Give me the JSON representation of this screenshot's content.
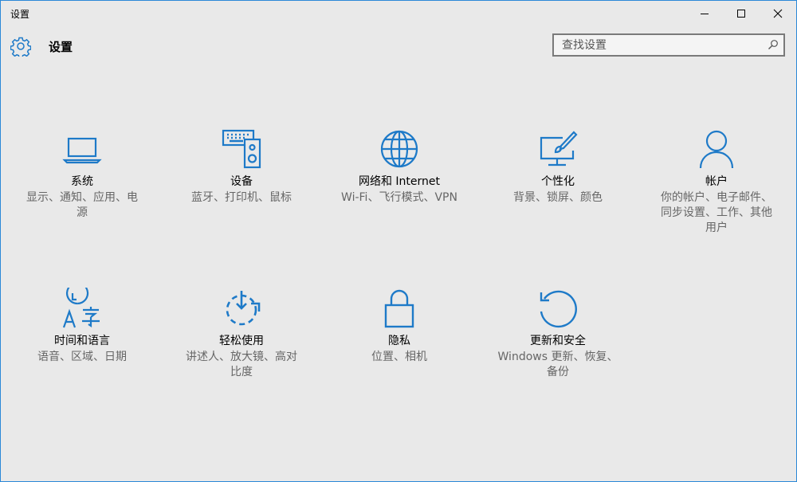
{
  "window": {
    "title": "设置",
    "controls": {
      "minimize": "minimize-icon",
      "maximize": "maximize-icon",
      "close": "close-icon"
    }
  },
  "header": {
    "title": "设置",
    "search_placeholder": "查找设置"
  },
  "accent_color": "#1e7ac8",
  "categories": [
    {
      "icon": "laptop-icon",
      "name": "系统",
      "desc": "显示、通知、应用、电源"
    },
    {
      "icon": "devices-icon",
      "name": "设备",
      "desc": "蓝牙、打印机、鼠标"
    },
    {
      "icon": "globe-icon",
      "name": "网络和 Internet",
      "desc": "Wi-Fi、飞行模式、VPN"
    },
    {
      "icon": "personalization-icon",
      "name": "个性化",
      "desc": "背景、锁屏、颜色"
    },
    {
      "icon": "person-icon",
      "name": "帐户",
      "desc": "你的帐户、电子邮件、同步设置、工作、其他用户"
    },
    {
      "icon": "time-language-icon",
      "name": "时间和语言",
      "desc": "语音、区域、日期"
    },
    {
      "icon": "ease-of-access-icon",
      "name": "轻松使用",
      "desc": "讲述人、放大镜、高对比度"
    },
    {
      "icon": "lock-icon",
      "name": "隐私",
      "desc": "位置、相机"
    },
    {
      "icon": "update-icon",
      "name": "更新和安全",
      "desc": "Windows 更新、恢复、备份"
    }
  ]
}
